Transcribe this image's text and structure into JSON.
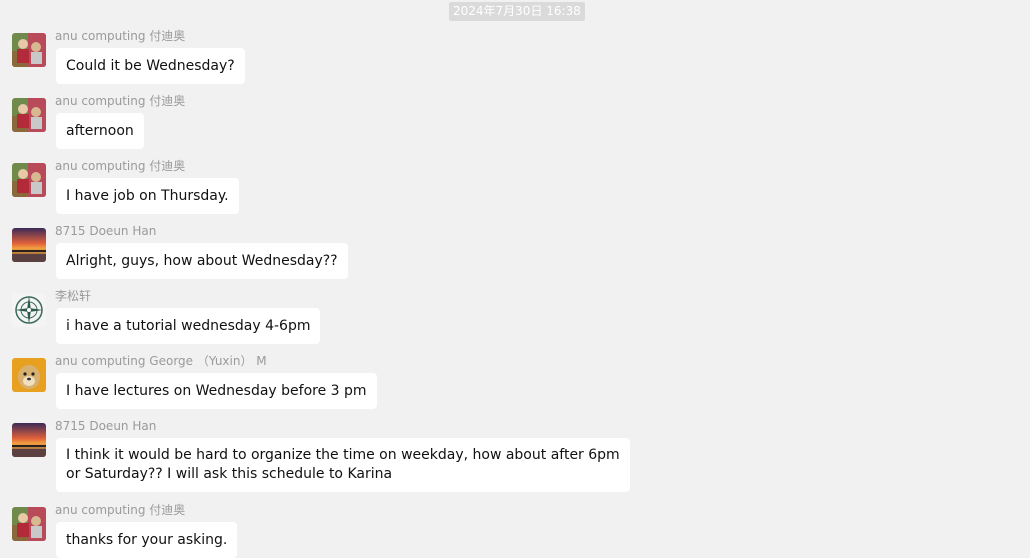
{
  "timestamp": "2024年7月30日 16:38",
  "messages": [
    {
      "sender": "anu computing 付迪奥",
      "avatar": "photo-avatar-icon",
      "lines": [
        "Could it be Wednesday?"
      ]
    },
    {
      "sender": "anu computing 付迪奥",
      "avatar": "photo-avatar-icon",
      "lines": [
        "afternoon"
      ]
    },
    {
      "sender": "anu computing 付迪奥",
      "avatar": "photo-avatar-icon",
      "lines": [
        "I have job on Thursday."
      ]
    },
    {
      "sender": "8715 Doeun Han",
      "avatar": "sunset-avatar-icon",
      "lines": [
        "Alright, guys, how about Wednesday??"
      ]
    },
    {
      "sender": "李松轩",
      "avatar": "compass-avatar-icon",
      "lines": [
        "i have a tutorial wednesday 4-6pm"
      ]
    },
    {
      "sender": "anu computing George （Yuxin） M",
      "avatar": "dog-avatar-icon",
      "lines": [
        "I have lectures on Wednesday before 3 pm"
      ]
    },
    {
      "sender": "8715 Doeun Han",
      "avatar": "sunset-avatar-icon",
      "lines": [
        "I think it would be hard to organize the time on weekday, how about after 6pm",
        "or Saturday?? I will ask this schedule to Karina"
      ]
    },
    {
      "sender": "anu computing 付迪奥",
      "avatar": "photo-avatar-icon",
      "lines": [
        "thanks for your asking."
      ]
    }
  ]
}
